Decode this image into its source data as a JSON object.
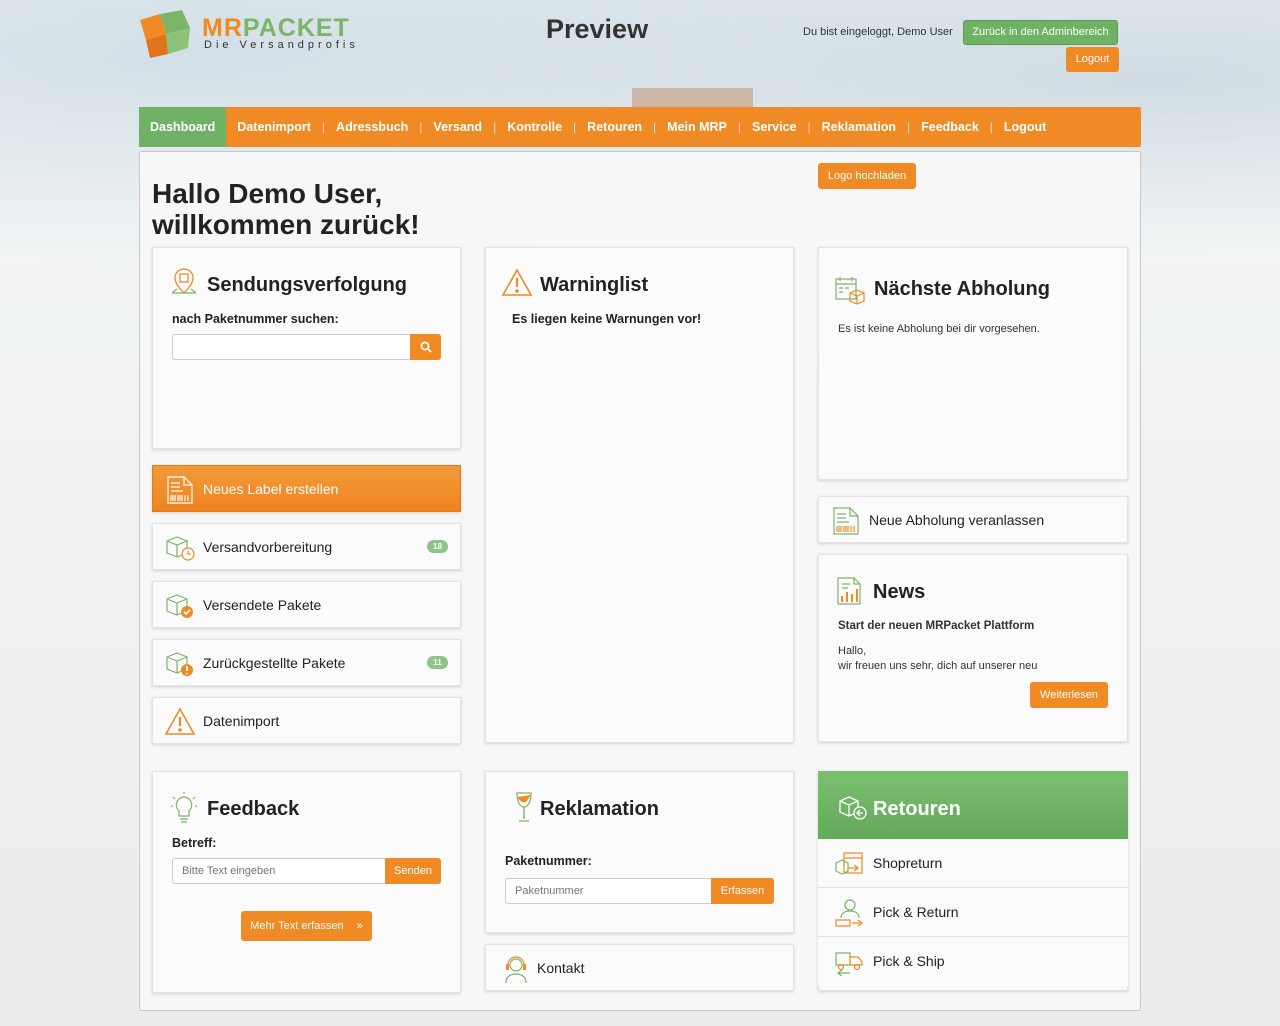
{
  "header": {
    "logo_primary": "MR",
    "logo_secondary": "PACKET",
    "logo_tagline": "Die Versandprofis",
    "title": "Preview",
    "logged_in_text": "Du bist eingeloggt, Demo User",
    "admin_button": "Zurück in den Adminbereich",
    "logout_button": "Logout"
  },
  "nav": {
    "items": [
      {
        "label": "Dashboard",
        "active": true
      },
      {
        "label": "Datenimport"
      },
      {
        "label": "Adressbuch"
      },
      {
        "label": "Versand"
      },
      {
        "label": "Kontrolle"
      },
      {
        "label": "Retouren"
      },
      {
        "label": "Mein MRP"
      },
      {
        "label": "Service"
      },
      {
        "label": "Reklamation"
      },
      {
        "label": "Feedback"
      },
      {
        "label": "Logout"
      }
    ],
    "separator": "|"
  },
  "greeting": {
    "line1": "Hallo Demo User,",
    "line2": "willkommen zurück!",
    "logo_upload_button": "Logo hochladen"
  },
  "tracking": {
    "title": "Sendungsverfolgung",
    "label": "nach Paketnummer suchen:",
    "input_value": ""
  },
  "warninglist": {
    "title": "Warninglist",
    "message": "Es liegen keine Warnungen vor!"
  },
  "pickup": {
    "title": "Nächste Abholung",
    "message": "Es ist keine Abholung bei dir vorgesehen."
  },
  "tiles": {
    "new_label": "Neues Label erstellen",
    "prep": {
      "label": "Versandvorbereitung",
      "badge": "18"
    },
    "sent": {
      "label": "Versendete Pakete"
    },
    "held": {
      "label": "Zurückgestellte Pakete",
      "badge": "11"
    },
    "import": {
      "label": "Datenimport"
    }
  },
  "new_pickup": {
    "label": "Neue Abholung veranlassen"
  },
  "news": {
    "title": "News",
    "headline": "Start der neuen MRPacket Plattform",
    "body_line1": "Hallo,",
    "body_line2": "wir freuen uns sehr, dich auf unserer neu",
    "read_more": "Weiterlesen"
  },
  "feedback": {
    "title": "Feedback",
    "subject_label": "Betreff:",
    "placeholder": "Bitte Text eingeben",
    "send": "Senden",
    "more": "Mehr Text erfassen",
    "more_icon": "»"
  },
  "complaint": {
    "title": "Reklamation",
    "label": "Paketnummer:",
    "placeholder": "Paketnummer",
    "submit": "Erfassen"
  },
  "contact": {
    "label": "Kontakt"
  },
  "returns": {
    "title": "Retouren",
    "items": [
      {
        "label": "Shopreturn"
      },
      {
        "label": "Pick & Return"
      },
      {
        "label": "Pick & Ship"
      }
    ]
  },
  "colors": {
    "orange": "#f08a24",
    "green": "#6fb266",
    "badge_green": "#8cc48a"
  }
}
